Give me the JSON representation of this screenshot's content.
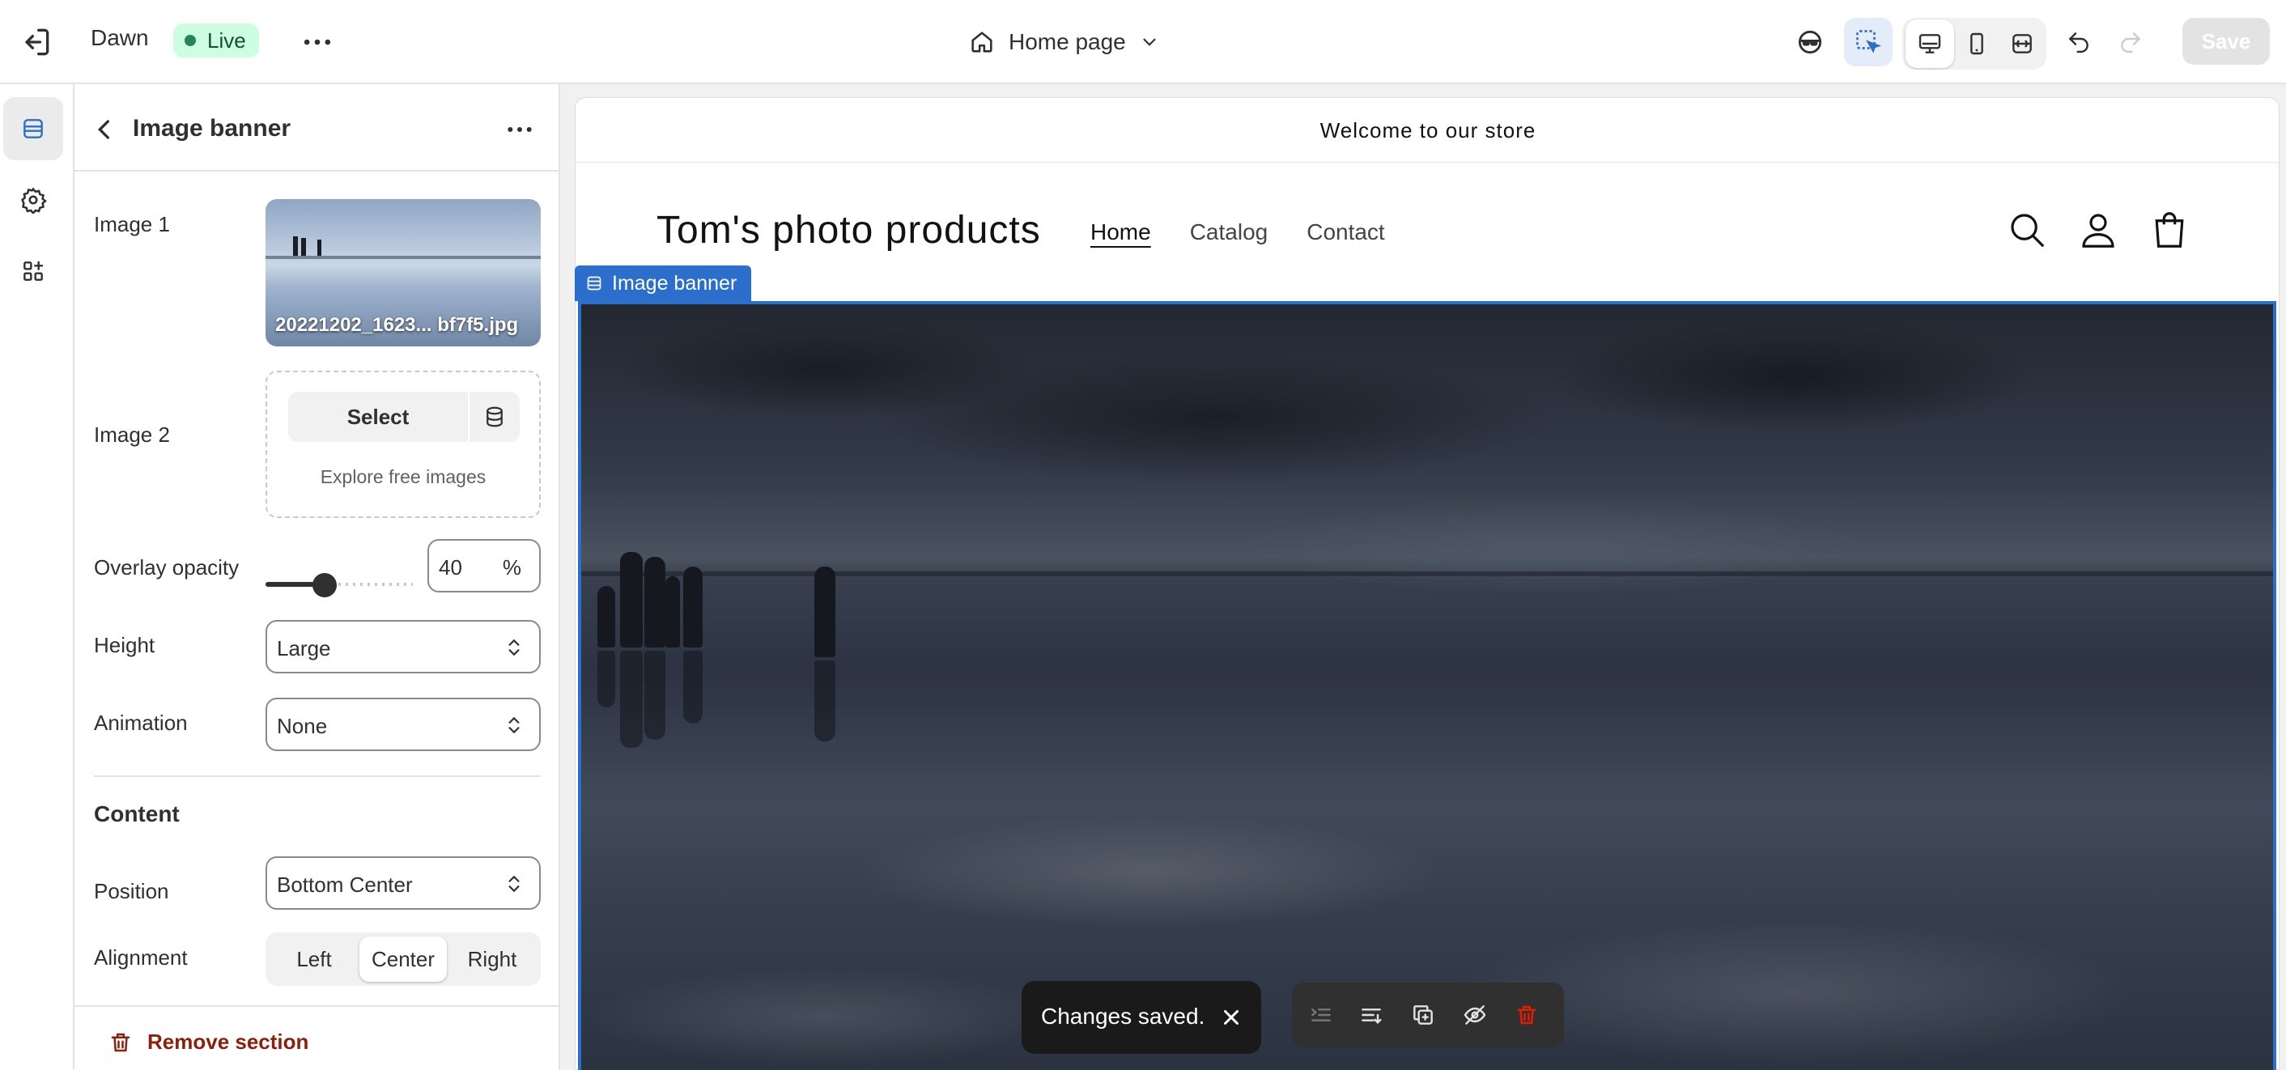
{
  "topbar": {
    "theme_name": "Dawn",
    "status_badge": "Live",
    "page_picker": "Home page",
    "save_label": "Save"
  },
  "panel": {
    "title": "Image banner",
    "image1_label": "Image 1",
    "image1_filename": "20221202_1623... bf7f5.jpg",
    "image2_label": "Image 2",
    "select_label": "Select",
    "explore_label": "Explore free images",
    "overlay_label": "Overlay opacity",
    "overlay_value": "40",
    "overlay_unit": "%",
    "overlay_fraction": 0.4,
    "height_label": "Height",
    "height_value": "Large",
    "animation_label": "Animation",
    "animation_value": "None",
    "content_title": "Content",
    "position_label": "Position",
    "position_value": "Bottom Center",
    "alignment_label": "Alignment",
    "alignment_options": [
      "Left",
      "Center",
      "Right"
    ],
    "alignment_selected": "Center",
    "remove_label": "Remove section"
  },
  "preview": {
    "announcement": "Welcome to our store",
    "store_name": "Tom's photo products",
    "nav": [
      "Home",
      "Catalog",
      "Contact"
    ],
    "nav_active": "Home",
    "banner_tag": "Image banner",
    "toast": "Changes saved."
  },
  "colors": {
    "accent": "#2c6ecb",
    "live_badge_bg": "#cdfee1",
    "remove_red": "#8e1f0b",
    "delete_red": "#e51c00"
  },
  "icons": {
    "exit": "exit-icon",
    "more": "more-horizontal-icon",
    "home": "home-icon",
    "chevron": "chevron-down-icon",
    "ai": "sidekick-icon",
    "inspector": "select-pointer-icon",
    "desktop": "desktop-icon",
    "mobile": "mobile-icon",
    "fullwidth": "full-width-icon",
    "undo": "undo-icon",
    "redo": "redo-icon",
    "sections": "sections-icon",
    "settings": "gear-icon",
    "apps": "apps-icon",
    "back": "chevron-left-icon",
    "library": "database-icon",
    "select_arrows": "select-arrows-icon",
    "trash": "trash-icon",
    "search": "search-icon",
    "account": "account-icon",
    "cart": "cart-icon",
    "close": "close-icon",
    "move_up": "indent-icon",
    "move_down": "outdent-icon",
    "duplicate": "duplicate-icon",
    "hide": "eye-off-icon",
    "delete": "trash-icon"
  }
}
